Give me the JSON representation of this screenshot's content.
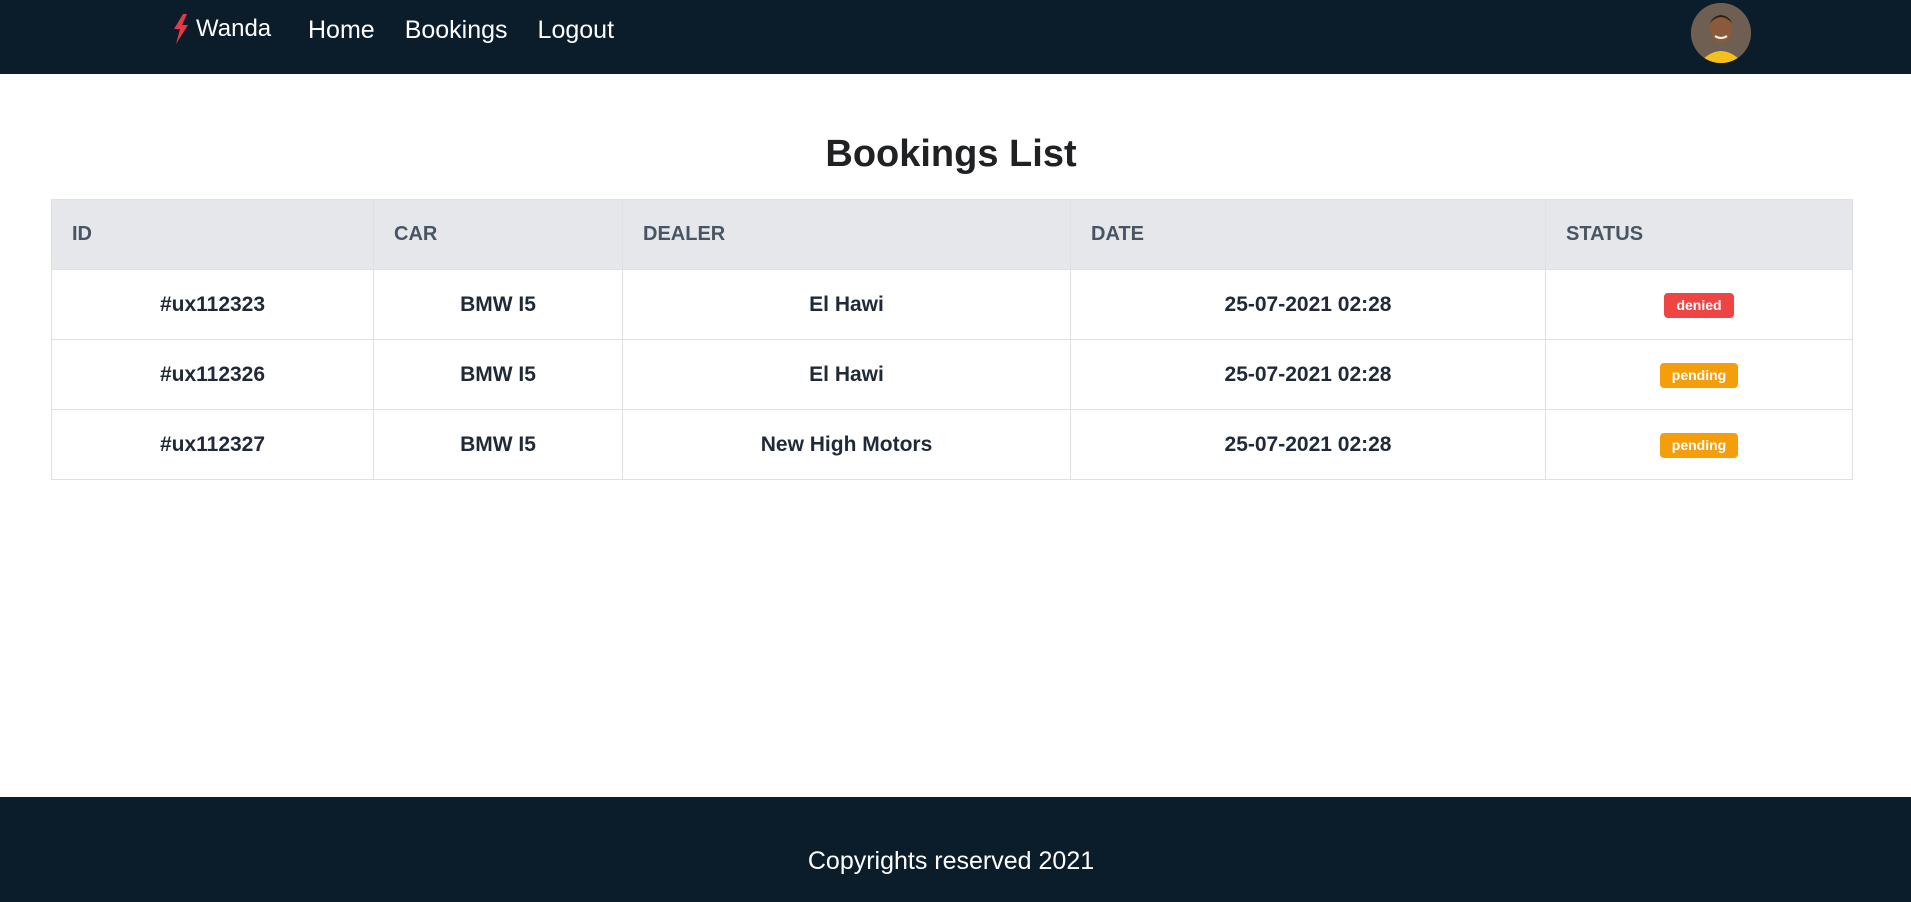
{
  "nav": {
    "brand": "Wanda",
    "logo_icon": "lightning-bolt-icon",
    "links": [
      "Home",
      "Bookings",
      "Logout"
    ],
    "avatar_icon": "user-avatar-photo"
  },
  "main": {
    "title": "Bookings List"
  },
  "table": {
    "headers": [
      "ID",
      "CAR",
      "DEALER",
      "DATE",
      "STATUS"
    ],
    "rows": [
      {
        "id": "#ux112323",
        "car": "BMW I5",
        "dealer": "El Hawi",
        "date": "25-07-2021 02:28",
        "status": "denied"
      },
      {
        "id": "#ux112326",
        "car": "BMW I5",
        "dealer": "El Hawi",
        "date": "25-07-2021 02:28",
        "status": "pending"
      },
      {
        "id": "#ux112327",
        "car": "BMW I5",
        "dealer": "New High Motors",
        "date": "25-07-2021 02:28",
        "status": "pending"
      }
    ]
  },
  "status_colors": {
    "denied": "#ef4444",
    "pending": "#f59e0b"
  },
  "colors": {
    "navbar": "#0b1c2b",
    "brand_accent": "#e63946"
  },
  "footer": {
    "text": "Copyrights reserved 2021"
  }
}
